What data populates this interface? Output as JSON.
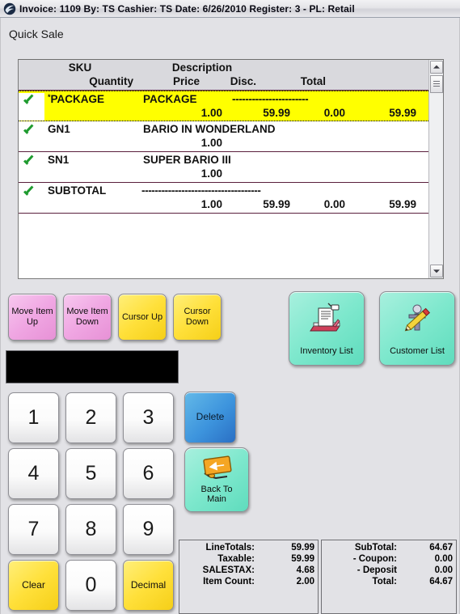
{
  "window": {
    "icon": "app-swoosh-icon",
    "title": "Invoice: 1109  By: TS   Cashier: TS    Date:  6/26/2010  Register: 3 - PL: Retail",
    "invoice_label": "Invoice:",
    "invoice_number": "1109",
    "by_label": "By:",
    "by_value": "TS",
    "cashier_label": "Cashier:",
    "cashier_value": "TS",
    "date_label": "Date:",
    "date_value": "6/26/2010",
    "register_label": "Register:",
    "register_value": "3",
    "price_level_label": "PL:",
    "price_level_value": "Retail"
  },
  "page": {
    "title": "Quick Sale"
  },
  "grid": {
    "headers_row1": [
      "SKU",
      "Description"
    ],
    "headers_row2": [
      "Quantity",
      "Price",
      "Disc.",
      "Total"
    ],
    "header_sku": "SKU",
    "header_description": "Description",
    "header_quantity": "Quantity",
    "header_price": "Price",
    "header_disc": "Disc.",
    "header_total": "Total",
    "rows": [
      {
        "checked": true,
        "sku": "PACKAGE",
        "sku_prefix": "*",
        "description": "PACKAGE",
        "dashes": "-----------------------",
        "quantity": "1.00",
        "price": "59.99",
        "disc": "0.00",
        "total": "59.99",
        "selected": true
      },
      {
        "checked": true,
        "sku": "GN1",
        "sku_prefix": "",
        "description": "BARIO IN WONDERLAND",
        "dashes": "",
        "quantity": "1.00",
        "price": "",
        "disc": "",
        "total": "",
        "selected": false
      },
      {
        "checked": true,
        "sku": "SN1",
        "sku_prefix": "",
        "description": "SUPER BARIO III",
        "dashes": "",
        "quantity": "1.00",
        "price": "",
        "disc": "",
        "total": "",
        "selected": false
      },
      {
        "checked": true,
        "sku": "SUBTOTAL",
        "sku_prefix": "",
        "description": "",
        "dashes": "------------------------------------",
        "quantity": "1.00",
        "price": "59.99",
        "disc": "0.00",
        "total": "59.99",
        "selected": false
      }
    ]
  },
  "scrollbar": {
    "up_icon": "chevron-up-icon",
    "down_icon": "chevron-down-icon",
    "thumb": "scroll-thumb"
  },
  "nav_buttons": [
    {
      "label": "Move Item Up",
      "line1": "Move Item",
      "line2": "Up",
      "color": "#f0a7e3"
    },
    {
      "label": "Move Item Down",
      "line1": "Move Item",
      "line2": "Down",
      "color": "#f0a7e3"
    },
    {
      "label": "Cursor Up",
      "line1": "Cursor Up",
      "line2": "",
      "color": "#ffe03a"
    },
    {
      "label": "Cursor Down",
      "line1": "Cursor",
      "line2": "Down",
      "color": "#ffe03a"
    }
  ],
  "list_buttons": [
    {
      "label": "Inventory List",
      "icon": "printer-document-icon",
      "color": "#7ee8cd"
    },
    {
      "label": "Customer List",
      "icon": "pencil-person-icon",
      "color": "#7ee8cd"
    }
  ],
  "display": {
    "value": ""
  },
  "keypad": {
    "keys": [
      "1",
      "2",
      "3",
      "4",
      "5",
      "6",
      "7",
      "8",
      "9"
    ],
    "zero": "0",
    "clear": "Clear",
    "decimal": "Decimal"
  },
  "action_buttons": {
    "delete": {
      "label": "Delete",
      "color": "#3d94dd"
    },
    "back_to_main": {
      "line1": "Back To",
      "line2": "Main",
      "label": "Back To Main",
      "icon": "back-arrow-sign-icon",
      "color": "#7ee8cd"
    }
  },
  "totals_left": [
    {
      "label": "LineTotals:",
      "value": "59.99"
    },
    {
      "label": "Taxable:",
      "value": "59.99"
    },
    {
      "label": "SALESTAX:",
      "value": "4.68"
    },
    {
      "label": "Item Count:",
      "value": "2.00"
    }
  ],
  "totals_right": [
    {
      "label": "SubTotal:",
      "value": "64.67"
    },
    {
      "label": "- Coupon:",
      "value": "0.00"
    },
    {
      "label": "- Deposit",
      "value": "0.00"
    },
    {
      "label": "Total:",
      "value": "64.67"
    }
  ],
  "colors": {
    "selected_row": "#ffff00",
    "row_divider": "#5a1f3c",
    "checkmark": "#1f9b2f",
    "window_bg": "#e2e2e6"
  }
}
